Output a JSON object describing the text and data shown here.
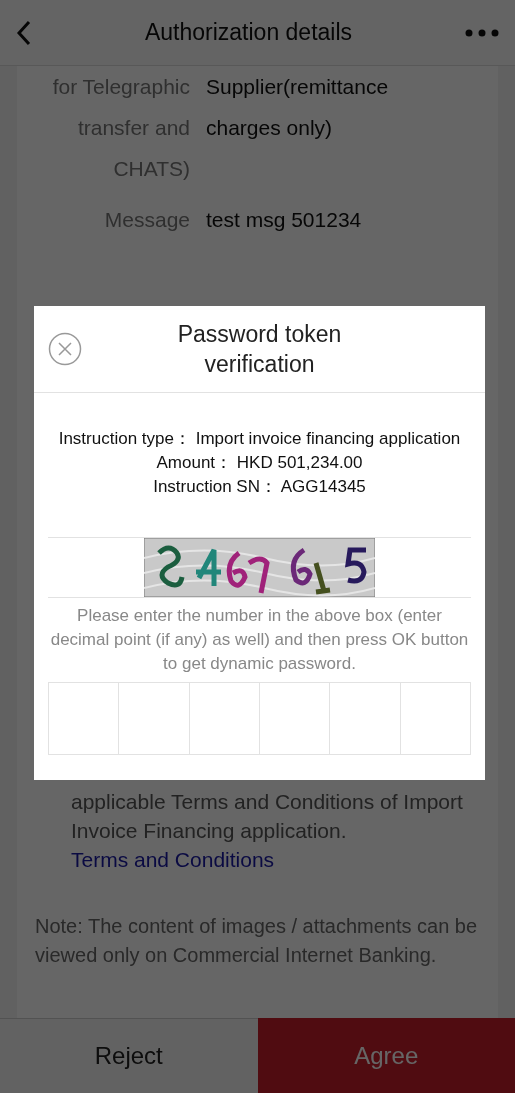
{
  "header": {
    "title": "Authorization details"
  },
  "details": [
    {
      "label": "for Telegraphic transfer and CHATS)",
      "value": "Supplier(remittance charges only)"
    },
    {
      "label": "Message",
      "value": "test msg 501234"
    }
  ],
  "terms": {
    "text": "applicable Terms and Conditions of Import Invoice Financing application.",
    "link": "Terms and Conditions"
  },
  "note": "Note: The content of images / attachments can be viewed only on Commercial Internet Banking.",
  "buttons": [
    {
      "label": "Reject",
      "kind": "secondary"
    },
    {
      "label": "Agree",
      "kind": "primary"
    }
  ],
  "dialog": {
    "title": "Password token verification",
    "info": [
      {
        "label": "Instruction type：",
        "value": "Import invoice financing application"
      },
      {
        "label": "Amount：",
        "value": "HKD  501,234.00"
      },
      {
        "label": "Instruction SN：",
        "value": "AGG14345"
      }
    ],
    "hint": "Please enter the number in the above box (enter decimal point (if any) as well) and then press OK button to get dynamic password."
  }
}
